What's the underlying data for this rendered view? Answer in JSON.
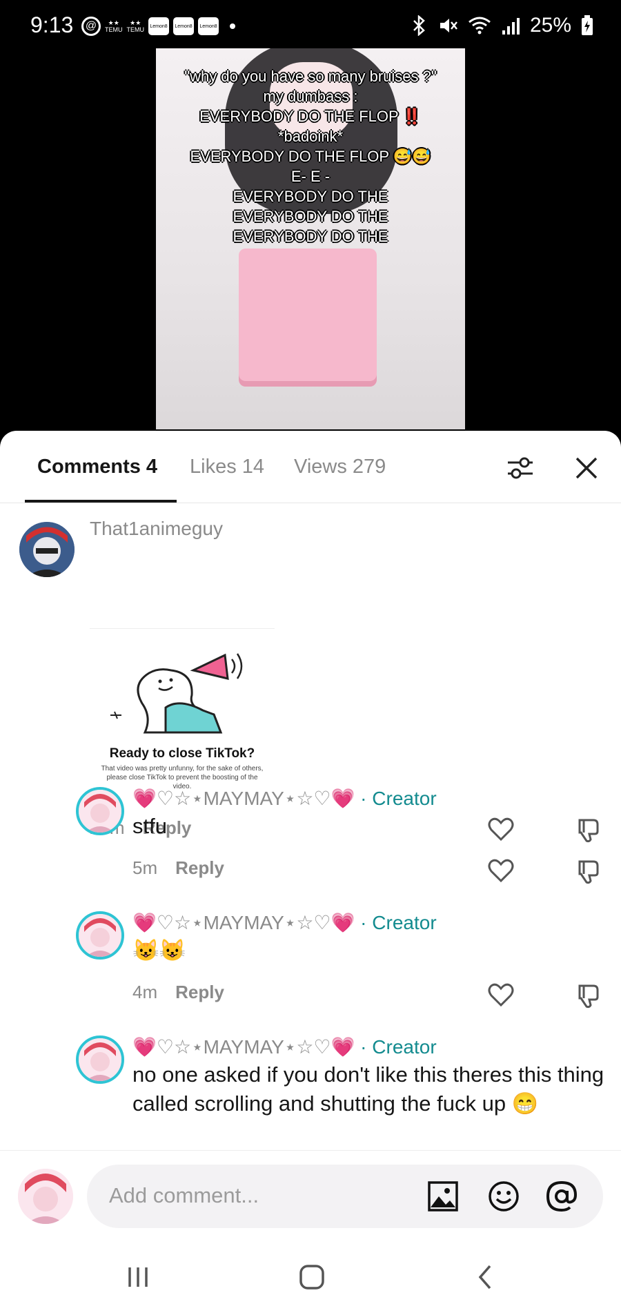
{
  "status_bar": {
    "time": "9:13",
    "temu_label": "TEMU",
    "chip_label": "Lemon8",
    "battery": "25%"
  },
  "video_overlay_lines": [
    "\"why do you have so many bruises ?\"",
    "my dumbass :",
    "EVERYBODY DO THE FLOP ‼️",
    "*badoink*",
    "EVERYBODY DO THE FLOP 😅😅",
    "E- E -",
    "EVERYBODY DO THE",
    "EVERYBODY DO THE",
    "EVERYBODY DO THE"
  ],
  "tabs": {
    "comments": "Comments 4",
    "likes": "Likes 14",
    "views": "Views 279"
  },
  "comments": [
    {
      "username": "That1animeguy",
      "card_title": "Ready to close TikTok?",
      "card_body": "That video was pretty unfunny, for the sake of others, please close TikTok to prevent the boosting of the video.",
      "time": "23m",
      "reply": "Reply"
    },
    {
      "username": "💗♡☆⋆MAYMAY⋆☆♡💗",
      "badge": "· Creator",
      "text": "stfu",
      "time": "5m",
      "reply": "Reply"
    },
    {
      "username": "💗♡☆⋆MAYMAY⋆☆♡💗",
      "badge": "· Creator",
      "text": "😺😺",
      "time": "4m",
      "reply": "Reply"
    },
    {
      "username": "💗♡☆⋆MAYMAY⋆☆♡💗",
      "badge": "· Creator",
      "text": "no one asked if you don't like this theres this thing called scrolling and shutting the fuck up 😁"
    }
  ],
  "input": {
    "placeholder": "Add comment..."
  },
  "colors": {
    "creator_badge": "#138b8f",
    "avatar_ring": "#2ec4d4"
  }
}
